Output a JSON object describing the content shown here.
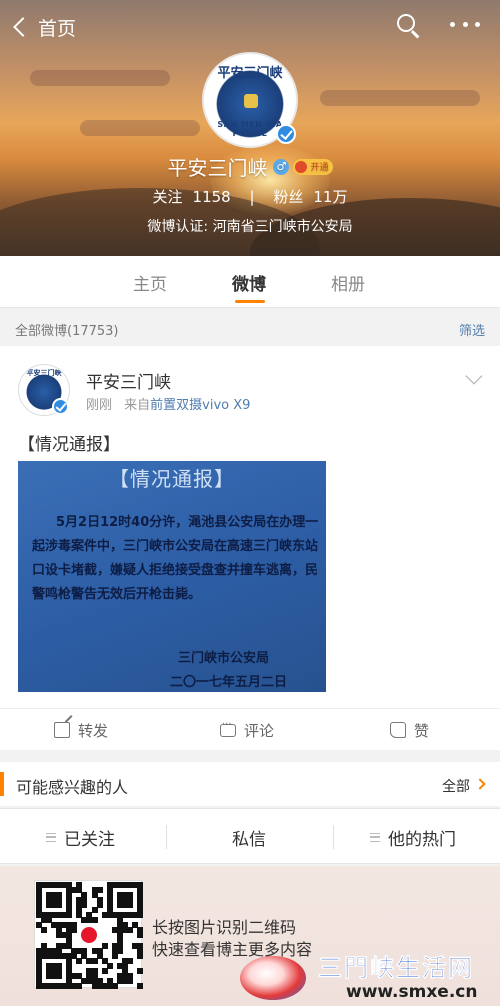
{
  "header": {
    "back_label": "首页",
    "avatar_top_text": "平安三门峡",
    "avatar_bottom_text": "SAN MEN XIA POLICE",
    "name": "平安三门峡",
    "gender_symbol": "♂",
    "vip_label": "开通",
    "following_label": "关注",
    "following_count": "1158",
    "followers_label": "粉丝",
    "followers_count": "11万",
    "verification": "微博认证: 河南省三门峡市公安局"
  },
  "tabs": [
    {
      "label": "主页",
      "active": false
    },
    {
      "label": "微博",
      "active": true
    },
    {
      "label": "相册",
      "active": false
    }
  ],
  "filter_bar": {
    "count_label": "全部微博(17753)",
    "filter_label": "筛选"
  },
  "post": {
    "author": "平安三门峡",
    "time": "刚刚",
    "from_label": "来自",
    "source": "前置双摄vivo X9",
    "text": "【情况通报】",
    "image": {
      "title": "【情况通报】",
      "body": "5月2日12时40分许，渑池县公安局在办理一起涉毒案件中，三门峡市公安局在高速三门峡东站口设卡堵截，嫌疑人拒绝接受盘查并撞车逃离，民警鸣枪警告无效后开枪击毙。",
      "signature": "三门峡市公安局",
      "date": "二〇一七年五月二日"
    },
    "actions": {
      "repost": "转发",
      "comment": "评论",
      "like": "赞"
    }
  },
  "people_section": {
    "title": "可能感兴趣的人",
    "all_label": "全部"
  },
  "bottom_bar": {
    "followed": "已关注",
    "message": "私信",
    "hot": "他的热门"
  },
  "qr_footer": {
    "line1": "长按图片识别二维码",
    "line2": "快速查看博主更多内容"
  },
  "watermark": {
    "title": "三門峡生活网",
    "url": "www.smxe.cn"
  },
  "colors": {
    "accent": "#ff8200",
    "link": "#507daf",
    "verified": "#2f8ce0",
    "notice_bg": "#2d5ea6"
  },
  "icons": [
    "back-chevron-icon",
    "search-icon",
    "more-icon",
    "verified-icon",
    "gender-icon",
    "vip-icon",
    "dropdown-caret-icon",
    "repost-icon",
    "comment-icon",
    "like-icon",
    "chevron-right-icon",
    "list-icon",
    "qr-code-icon",
    "weibo-logo-icon"
  ]
}
